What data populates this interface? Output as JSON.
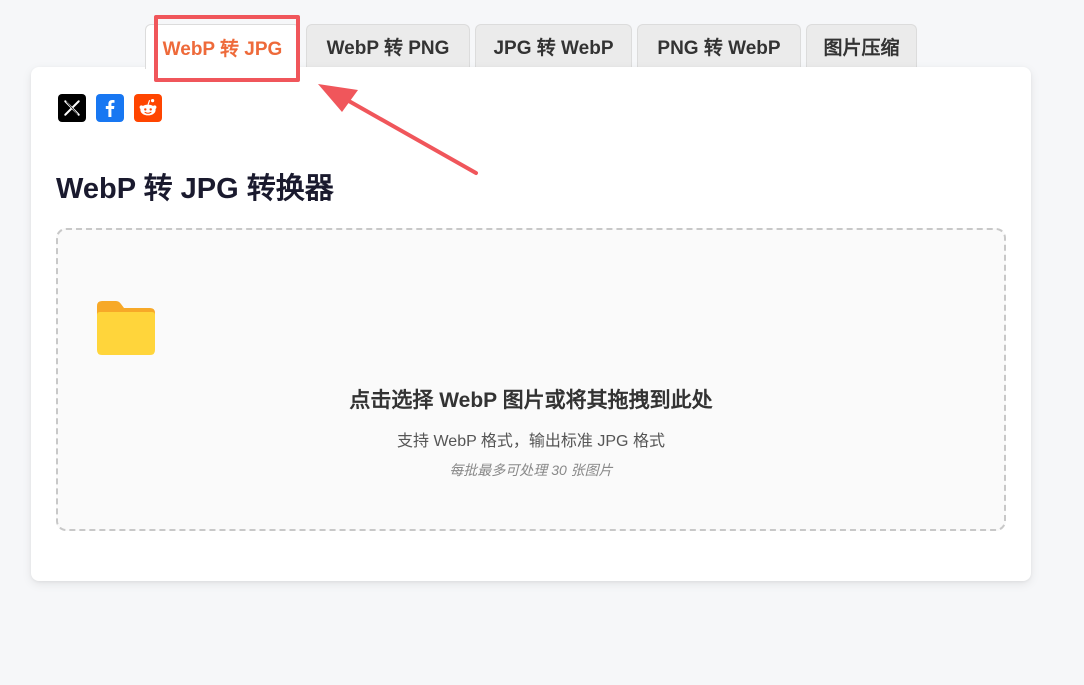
{
  "tabs": [
    {
      "label": "WebP 转 JPG",
      "active": true
    },
    {
      "label": "WebP 转 PNG",
      "active": false
    },
    {
      "label": "JPG 转 WebP",
      "active": false
    },
    {
      "label": "PNG 转 WebP",
      "active": false
    },
    {
      "label": "图片压缩",
      "active": false
    }
  ],
  "share": {
    "icons": [
      "x-icon",
      "facebook-icon",
      "reddit-icon"
    ]
  },
  "main": {
    "title": "WebP 转 JPG 转换器"
  },
  "dropzone": {
    "title": "点击选择 WebP 图片或将其拖拽到此处",
    "subtitle": "支持 WebP 格式，输出标准 JPG 格式",
    "note": "每批最多可处理 30 张图片",
    "icon": "folder-icon"
  },
  "colors": {
    "active_tab": "#ee6a3a",
    "annotation": "#f0565b",
    "folder": "#ffc83d"
  }
}
